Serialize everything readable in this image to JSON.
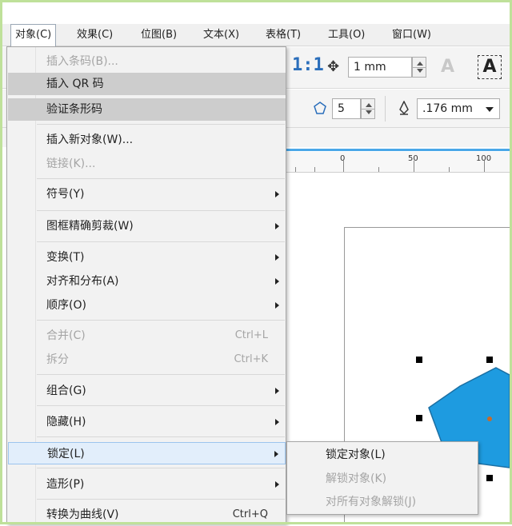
{
  "menubar": {
    "items": [
      "对象(C)",
      "效果(C)",
      "位图(B)",
      "文本(X)",
      "表格(T)",
      "工具(O)",
      "窗口(W)"
    ]
  },
  "toolbar": {
    "ratio_label": "1:1",
    "nudge_value": "1 mm",
    "sides_value": "5",
    "outline_value": ".176 mm",
    "text_icon_a": "A",
    "text_icon_b": "A"
  },
  "ruler": {
    "labels": [
      "0",
      "50",
      "100"
    ]
  },
  "object_menu": {
    "items": [
      {
        "label": "插入条码(B)...",
        "shortcut": "",
        "submenu": false,
        "disabled": true,
        "state": "normal"
      },
      {
        "label": "插入 QR 码",
        "shortcut": "",
        "submenu": false,
        "disabled": false,
        "state": "highlighted"
      },
      {
        "label": "验证条形码",
        "shortcut": "",
        "submenu": false,
        "disabled": false,
        "state": "highlighted"
      },
      {
        "label": "插入新对象(W)...",
        "shortcut": "",
        "submenu": false,
        "disabled": false,
        "state": "normal"
      },
      {
        "label": "链接(K)...",
        "shortcut": "",
        "submenu": false,
        "disabled": true,
        "state": "normal"
      },
      {
        "label": "符号(Y)",
        "shortcut": "",
        "submenu": true,
        "disabled": false,
        "state": "normal"
      },
      {
        "label": "图框精确剪裁(W)",
        "shortcut": "",
        "submenu": true,
        "disabled": false,
        "state": "normal"
      },
      {
        "label": "变换(T)",
        "shortcut": "",
        "submenu": true,
        "disabled": false,
        "state": "normal"
      },
      {
        "label": "对齐和分布(A)",
        "shortcut": "",
        "submenu": true,
        "disabled": false,
        "state": "normal"
      },
      {
        "label": "顺序(O)",
        "shortcut": "",
        "submenu": true,
        "disabled": false,
        "state": "normal"
      },
      {
        "label": "合并(C)",
        "shortcut": "Ctrl+L",
        "submenu": false,
        "disabled": true,
        "state": "normal"
      },
      {
        "label": "拆分",
        "shortcut": "Ctrl+K",
        "submenu": false,
        "disabled": true,
        "state": "normal"
      },
      {
        "label": "组合(G)",
        "shortcut": "",
        "submenu": true,
        "disabled": false,
        "state": "normal"
      },
      {
        "label": "隐藏(H)",
        "shortcut": "",
        "submenu": true,
        "disabled": false,
        "state": "normal"
      },
      {
        "label": "锁定(L)",
        "shortcut": "",
        "submenu": true,
        "disabled": false,
        "state": "selected"
      },
      {
        "label": "造形(P)",
        "shortcut": "",
        "submenu": true,
        "disabled": false,
        "state": "normal"
      },
      {
        "label": "转换为曲线(V)",
        "shortcut": "Ctrl+Q",
        "submenu": false,
        "disabled": false,
        "state": "normal"
      }
    ]
  },
  "lock_submenu": {
    "items": [
      {
        "label": "锁定对象(L)",
        "disabled": false
      },
      {
        "label": "解锁对象(K)",
        "disabled": true
      },
      {
        "label": "对所有对象解锁(J)",
        "disabled": true
      }
    ]
  },
  "colors": {
    "shape_fill": "#1e9be0",
    "shape_stroke": "#1b6fa3",
    "menu_bg": "#f2f2f2",
    "highlight": "#cdcdcd",
    "selected": "#e2eefb",
    "ruler_line": "#4aa8e8"
  }
}
